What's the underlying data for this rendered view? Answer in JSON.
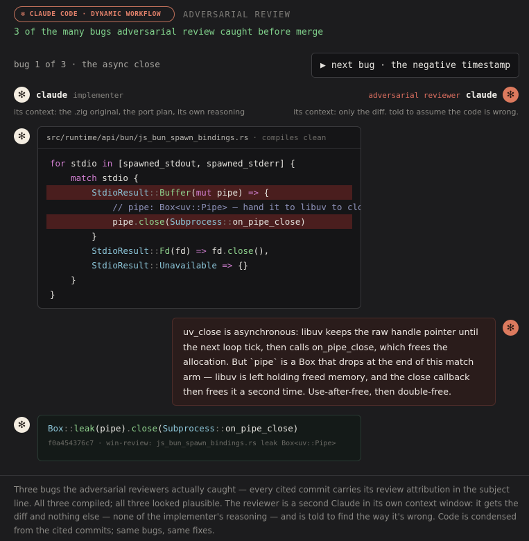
{
  "header": {
    "badge_icon": "✻",
    "badge_label": "CLAUDE CODE · DYNAMIC WORKFLOW",
    "section_label": "ADVERSARIAL REVIEW",
    "headline": "3 of the many bugs adversarial review caught before merge"
  },
  "nav": {
    "bug_counter": "bug 1 of 3 · the async close",
    "next_arrow": "▶",
    "next_label": "next bug · the negative timestamp"
  },
  "implementer": {
    "avatar_icon": "✻",
    "name": "claude",
    "role": "implementer",
    "context": "its context: the .zig original, the port plan, its own reasoning"
  },
  "reviewer": {
    "avatar_icon": "✻",
    "role": "adversarial reviewer",
    "name": "claude",
    "context": "its context: only the diff. told to assume the code is wrong."
  },
  "code_card": {
    "file": "src/runtime/api/bun/js_bun_spawn_bindings.rs",
    "status": "· compiles clean"
  },
  "reviewer_message": "uv_close is asynchronous: libuv keeps the raw handle pointer until the next loop tick, then calls on_pipe_close, which frees the allocation. But `pipe` is a Box that drops at the end of this match arm — libuv is left holding freed memory, and the close callback then frees it a second time. Use-after-free, then double-free.",
  "fix_card": {
    "commit": "f0a454376c7 · win-review: js_bun_spawn_bindings.rs leak Box<uv::Pipe>"
  },
  "footer": "Three bugs the adversarial reviewers actually caught — every cited commit carries its review attribution in the subject line. All three compiled; all three looked plausible. The reviewer is a second Claude in its own context window: it gets the diff and nothing else — none of the implementer's reasoning — and is told to find the way it's wrong. Code is condensed from the cited commits; same bugs, same fixes.",
  "colors": {
    "accent": "#dc7a5e",
    "headline_green": "#7fce8a",
    "highlight_red": "#4a1e1e",
    "reviewer_red": "#dd6f60"
  }
}
